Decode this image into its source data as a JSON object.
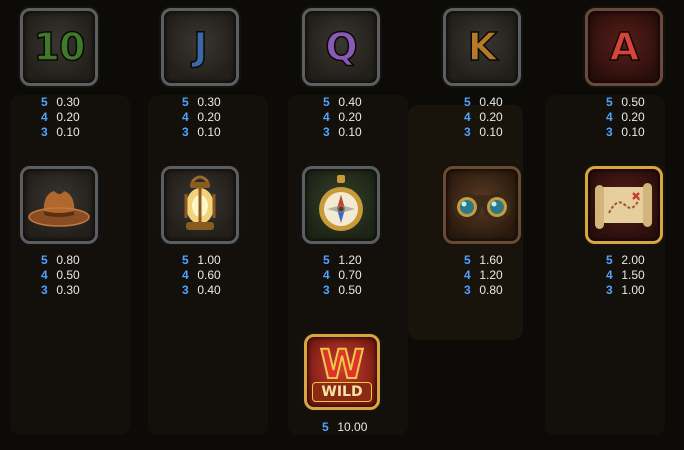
{
  "paytable": {
    "row1": [
      {
        "name": "10",
        "label": "10",
        "color": "#3f7a2a",
        "pays": [
          {
            "n": "5",
            "v": "0.30"
          },
          {
            "n": "4",
            "v": "0.20"
          },
          {
            "n": "3",
            "v": "0.10"
          }
        ]
      },
      {
        "name": "J",
        "label": "J",
        "color": "#3a68a8",
        "pays": [
          {
            "n": "5",
            "v": "0.30"
          },
          {
            "n": "4",
            "v": "0.20"
          },
          {
            "n": "3",
            "v": "0.10"
          }
        ]
      },
      {
        "name": "Q",
        "label": "Q",
        "color": "#8a5bb4",
        "pays": [
          {
            "n": "5",
            "v": "0.40"
          },
          {
            "n": "4",
            "v": "0.20"
          },
          {
            "n": "3",
            "v": "0.10"
          }
        ]
      },
      {
        "name": "K",
        "label": "K",
        "color": "#b47a2a",
        "pays": [
          {
            "n": "5",
            "v": "0.40"
          },
          {
            "n": "4",
            "v": "0.20"
          },
          {
            "n": "3",
            "v": "0.10"
          }
        ]
      },
      {
        "name": "A",
        "label": "A",
        "color": "#c93a32",
        "pays": [
          {
            "n": "5",
            "v": "0.50"
          },
          {
            "n": "4",
            "v": "0.20"
          },
          {
            "n": "3",
            "v": "0.10"
          }
        ]
      }
    ],
    "row2": [
      {
        "name": "hat-icon",
        "pays": [
          {
            "n": "5",
            "v": "0.80"
          },
          {
            "n": "4",
            "v": "0.50"
          },
          {
            "n": "3",
            "v": "0.30"
          }
        ]
      },
      {
        "name": "lantern-icon",
        "pays": [
          {
            "n": "5",
            "v": "1.00"
          },
          {
            "n": "4",
            "v": "0.60"
          },
          {
            "n": "3",
            "v": "0.40"
          }
        ]
      },
      {
        "name": "compass-icon",
        "pays": [
          {
            "n": "5",
            "v": "1.20"
          },
          {
            "n": "4",
            "v": "0.70"
          },
          {
            "n": "3",
            "v": "0.50"
          }
        ]
      },
      {
        "name": "binoculars-icon",
        "pays": [
          {
            "n": "5",
            "v": "1.60"
          },
          {
            "n": "4",
            "v": "1.20"
          },
          {
            "n": "3",
            "v": "0.80"
          }
        ]
      },
      {
        "name": "map-icon",
        "pays": [
          {
            "n": "5",
            "v": "2.00"
          },
          {
            "n": "4",
            "v": "1.50"
          },
          {
            "n": "3",
            "v": "1.00"
          }
        ]
      }
    ],
    "wild": {
      "name": "wild-icon",
      "letter": "W",
      "label": "WILD",
      "pays": [
        {
          "n": "5",
          "v": "10.00"
        }
      ]
    }
  }
}
